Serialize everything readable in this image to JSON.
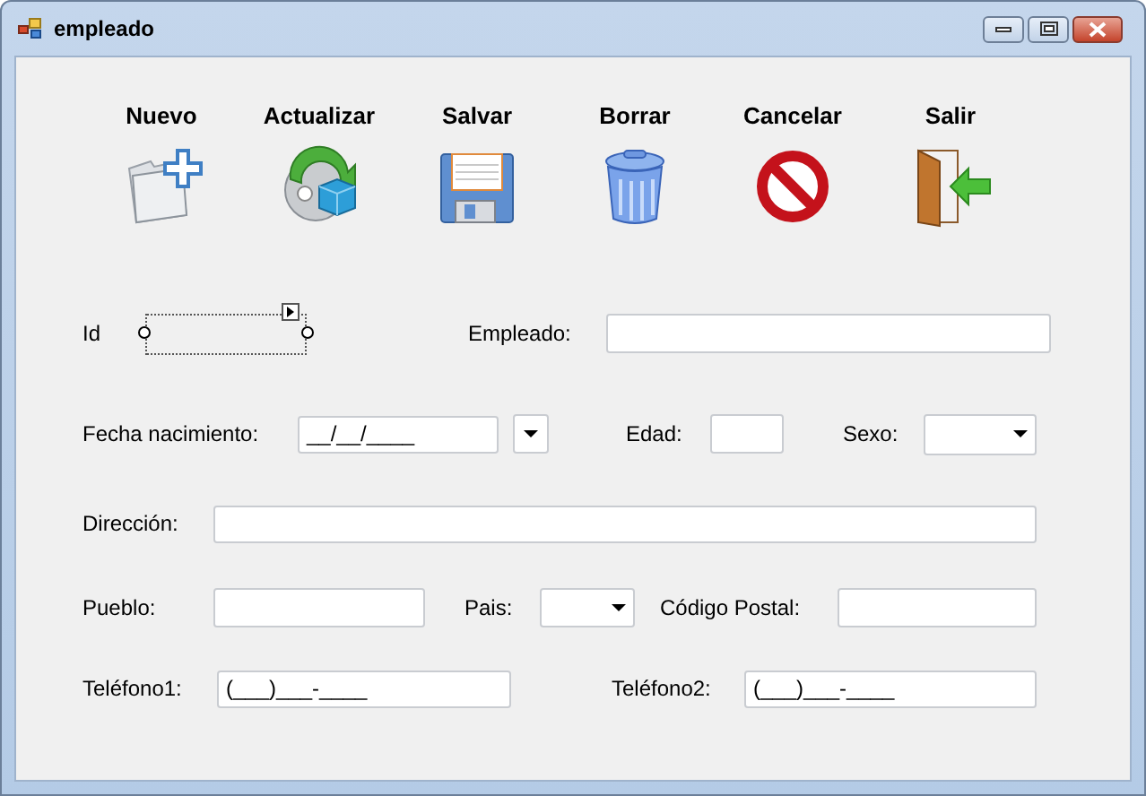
{
  "window": {
    "title": "empleado"
  },
  "toolbar": [
    {
      "label": "Nuevo",
      "kind": "new"
    },
    {
      "label": "Actualizar",
      "kind": "refresh"
    },
    {
      "label": "Salvar",
      "kind": "save"
    },
    {
      "label": "Borrar",
      "kind": "delete"
    },
    {
      "label": "Cancelar",
      "kind": "cancel"
    },
    {
      "label": "Salir",
      "kind": "exit"
    }
  ],
  "form": {
    "rows": [
      {
        "fields": [
          {
            "label": "Id",
            "kind": "designer-box",
            "selected": true
          },
          {
            "label": "Empleado:",
            "kind": "text"
          }
        ]
      },
      {
        "fields": [
          {
            "label": "Fecha nacimiento:",
            "kind": "text",
            "value": "__/__/____"
          },
          {
            "kind": "dropbutton"
          },
          {
            "label": "Edad:",
            "kind": "text"
          },
          {
            "label": "Sexo:",
            "kind": "combo"
          }
        ]
      },
      {
        "fields": [
          {
            "label": "Dirección:",
            "kind": "text"
          }
        ]
      },
      {
        "fields": [
          {
            "label": "Pueblo:",
            "kind": "text"
          },
          {
            "label": "Pais:",
            "kind": "combo"
          },
          {
            "label": "Código Postal:",
            "kind": "text"
          }
        ]
      },
      {
        "fields": [
          {
            "label": "Teléfono1:",
            "kind": "text",
            "value": "(___)___-____"
          },
          {
            "label": "Teléfono2:",
            "kind": "text",
            "value": "(___)___-____"
          }
        ]
      }
    ]
  }
}
